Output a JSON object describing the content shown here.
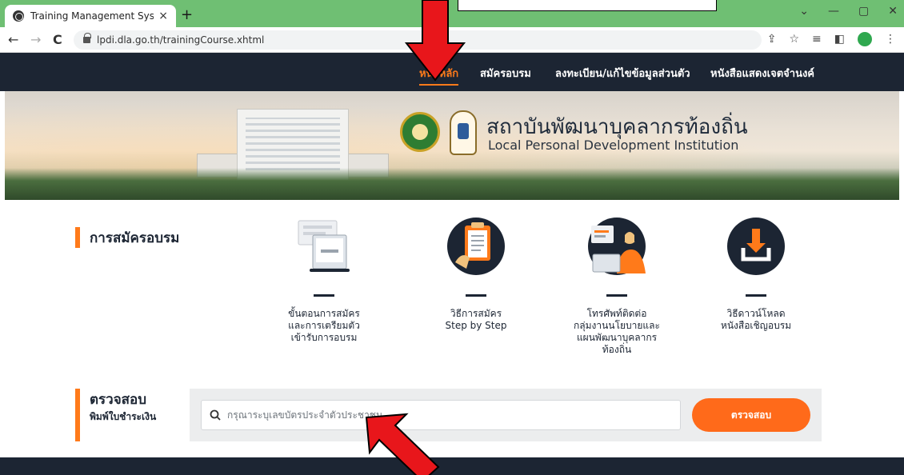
{
  "browser": {
    "tab_title": "Training Management System",
    "tab_close": "×",
    "new_tab": "+",
    "url": "lpdi.dla.go.th/trainingCourse.xhtml",
    "controls": {
      "minimize": "—",
      "maximize": "▢",
      "close": "✕",
      "dropdown": "⌄"
    },
    "nav": {
      "back": "←",
      "forward": "→",
      "reload": "C"
    }
  },
  "nav": {
    "items": [
      {
        "label": "หน้าหลัก",
        "active": true
      },
      {
        "label": "สมัครอบรม",
        "active": false
      },
      {
        "label": "ลงทะเบียน/แก้ไขข้อมูลส่วนตัว",
        "active": false
      },
      {
        "label": "หนังสือแสดงเจตจำนงค์",
        "active": false
      }
    ]
  },
  "banner": {
    "title_th": "สถาบันพัฒนาบุคลากรท้องถิ่น",
    "title_en": "Local Personal Development Institution"
  },
  "apply_section": {
    "title": "การสมัครอบรม",
    "features": [
      {
        "icon": "registration-form-icon",
        "label_lines": [
          "ขั้นตอนการสมัคร",
          "และการเตรียมตัว",
          "เข้ารับการอบรม"
        ]
      },
      {
        "icon": "checklist-icon",
        "label_lines": [
          "วิธีการสมัคร",
          "Step by Step"
        ]
      },
      {
        "icon": "call-center-icon",
        "label_lines": [
          "โทรศัพท์ติดต่อ",
          "กลุ่มงานนโยบายและ",
          "แผนพัฒนาบุคลากร",
          "ท้องถิ่น"
        ]
      },
      {
        "icon": "download-icon",
        "label_lines": [
          "วิธีดาวน์โหลด",
          "หนังสือเชิญอบรม"
        ]
      }
    ]
  },
  "check_section": {
    "title": "ตรวจสอบ",
    "subtitle": "พิมพ์ใบชำระเงิน",
    "search_placeholder": "กรุณาระบุเลขบัตรประจำตัวประชาชน",
    "search_value": "",
    "button_label": "ตรวจสอบ"
  },
  "colors": {
    "accent": "#ff7a1a",
    "nav_bg": "#1c2533",
    "annotation_arrow": "#e8161b"
  }
}
